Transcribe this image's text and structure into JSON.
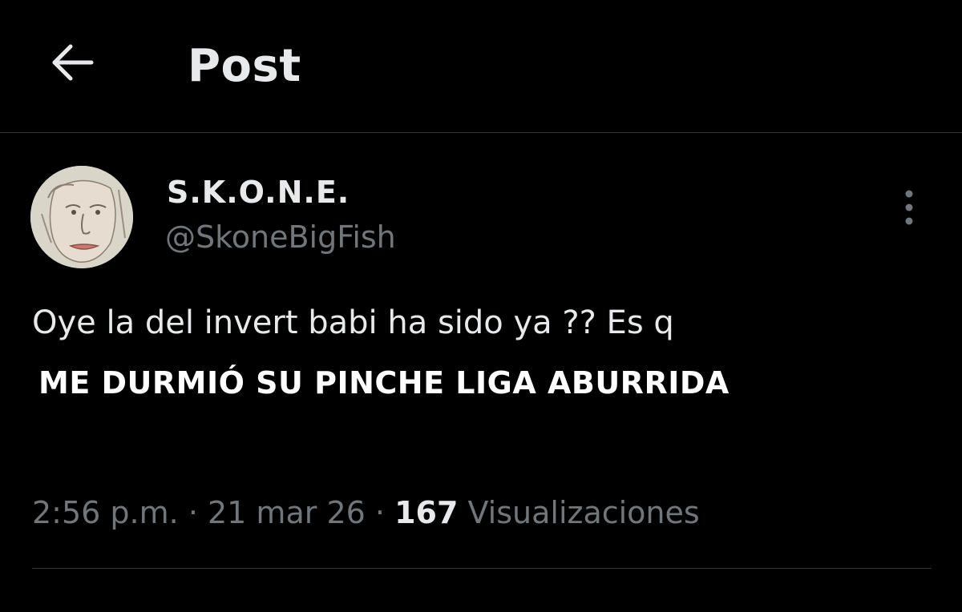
{
  "header": {
    "title": "Post",
    "back_icon": "arrow-left-icon"
  },
  "author": {
    "display_name": "S.K.O.N.E.",
    "handle": "@SkoneBigFish",
    "avatar": "avatar-sketch-face"
  },
  "post": {
    "text": "Oye la del invert babi ha sido ya ?? Es q",
    "caption": "ME DURMIÓ SU PINCHE LIGA ABURRIDA",
    "time": "2:56 p.m.",
    "separator": "·",
    "date": "21 mar 26",
    "views_count": "167",
    "views_label": "Visualizaciones"
  },
  "more_icon": "more-vertical-icon",
  "colors": {
    "background": "#000000",
    "primary_text": "#e7e9ea",
    "secondary_text": "#71767b",
    "border": "#2f3336"
  }
}
